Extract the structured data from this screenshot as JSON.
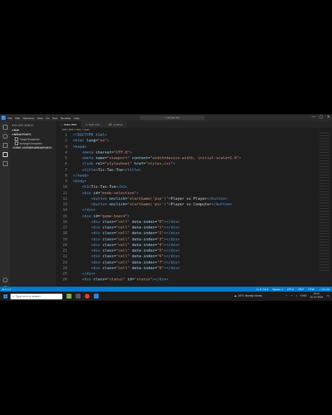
{
  "window": {
    "menu": [
      "File",
      "Edit",
      "Selection",
      "View",
      "Go",
      "Run",
      "Terminal",
      "Help"
    ],
    "search": "tic-tac-toe",
    "controls": [
      "—",
      "▢",
      "✕"
    ]
  },
  "sidebar": {
    "title": "RUN AND DEBUG",
    "run_label": "RUN",
    "breakpoints_label": "BREAKPOINTS",
    "breakpoints": [
      "Caught Exceptions",
      "Uncaught Exceptions"
    ],
    "event_listener_label": "EVENT LISTENER BREAKPOINTS"
  },
  "tabs": [
    {
      "label": "index.html",
      "icon": "html-icon",
      "active": true
    },
    {
      "label": "style.css",
      "icon": "css-icon",
      "active": false
    },
    {
      "label": "script.js",
      "icon": "js-icon",
      "active": false
    }
  ],
  "breadcrumb": "index.html > html > head",
  "editor": {
    "lines": [
      {
        "n": "1",
        "html": "<span class='tag'>&lt;!DOCTYPE html&gt;</span>"
      },
      {
        "n": "2",
        "html": "<span class='tag'>&lt;html</span> <span class='attr'>lang</span>=<span class='str'>\"en\"</span><span class='tag'>&gt;</span>"
      },
      {
        "n": "3",
        "html": "<span class='tag'>&lt;head&gt;</span>"
      },
      {
        "n": "4",
        "html": "    <span class='tag'>&lt;meta</span> <span class='attr'>charset</span>=<span class='str'>\"UTF-8\"</span><span class='tag'>&gt;</span>"
      },
      {
        "n": "5",
        "html": "    <span class='tag'>&lt;meta</span> <span class='attr'>name</span>=<span class='str'>\"viewport\"</span> <span class='attr'>content</span>=<span class='str'>\"width=device-width, initial-scale=1.0\"</span><span class='tag'>&gt;</span>"
      },
      {
        "n": "6",
        "html": "    <span class='tag'>&lt;link</span> <span class='attr'>rel</span>=<span class='str'>\"stylesheet\"</span> <span class='attr'>href</span>=<span class='str'>\"styles.css\"</span><span class='tag'>&gt;</span>"
      },
      {
        "n": "7",
        "html": "    <span class='tag'>&lt;title&gt;</span>Tic-Tac-Toe<span class='tag'>&lt;/title&gt;</span>"
      },
      {
        "n": "8",
        "html": "<span class='tag'>&lt;/head&gt;</span>"
      },
      {
        "n": "9",
        "html": "<span class='tag'>&lt;body&gt;</span>"
      },
      {
        "n": "10",
        "html": "    <span class='tag'>&lt;h1&gt;</span>Tic-Tac-Toe<span class='tag'>&lt;/h1&gt;</span>"
      },
      {
        "n": "11",
        "html": "    <span class='tag'>&lt;div</span> <span class='attr'>id</span>=<span class='str'>\"mode-selection\"</span><span class='tag'>&gt;</span>"
      },
      {
        "n": "12",
        "html": "        <span class='tag'>&lt;button</span> <span class='attr'>onclick</span>=<span class='str'>\"startGame('pvp')\"</span><span class='tag'>&gt;</span>Player vs Player<span class='tag'>&lt;/button&gt;</span>"
      },
      {
        "n": "13",
        "html": "        <span class='tag'>&lt;button</span> <span class='attr'>onclick</span>=<span class='str'>\"startGame('pvc')\"</span><span class='tag'>&gt;</span>Player vs Computer<span class='tag'>&lt;/button&gt;</span>"
      },
      {
        "n": "14",
        "html": "    <span class='tag'>&lt;/div&gt;</span>"
      },
      {
        "n": "15",
        "html": "    <span class='tag'>&lt;div</span> <span class='attr'>id</span>=<span class='str'>\"game-board\"</span><span class='tag'>&gt;</span>"
      },
      {
        "n": "16",
        "html": "        <span class='tag'>&lt;div</span> <span class='attr'>class</span>=<span class='str'>\"cell\"</span> <span class='attr'>data-index</span>=<span class='str'>\"0\"</span><span class='tag'>&gt;&lt;/div&gt;</span>"
      },
      {
        "n": "17",
        "html": "        <span class='tag'>&lt;div</span> <span class='attr'>class</span>=<span class='str'>\"cell\"</span> <span class='attr'>data-index</span>=<span class='str'>\"1\"</span><span class='tag'>&gt;&lt;/div&gt;</span>"
      },
      {
        "n": "18",
        "html": "        <span class='tag'>&lt;div</span> <span class='attr'>class</span>=<span class='str'>\"cell\"</span> <span class='attr'>data-index</span>=<span class='str'>\"2\"</span><span class='tag'>&gt;&lt;/div&gt;</span>"
      },
      {
        "n": "19",
        "html": "        <span class='tag'>&lt;div</span> <span class='attr'>class</span>=<span class='str'>\"cell\"</span> <span class='attr'>data-index</span>=<span class='str'>\"3\"</span><span class='tag'>&gt;&lt;/div&gt;</span>"
      },
      {
        "n": "20",
        "html": "        <span class='tag'>&lt;div</span> <span class='attr'>class</span>=<span class='str'>\"cell\"</span> <span class='attr'>data-index</span>=<span class='str'>\"4\"</span><span class='tag'>&gt;&lt;/div&gt;</span>"
      },
      {
        "n": "21",
        "html": "        <span class='tag'>&lt;div</span> <span class='attr'>class</span>=<span class='str'>\"cell\"</span> <span class='attr'>data-index</span>=<span class='str'>\"5\"</span><span class='tag'>&gt;&lt;/div&gt;</span>"
      },
      {
        "n": "22",
        "html": "        <span class='tag'>&lt;div</span> <span class='attr'>class</span>=<span class='str'>\"cell\"</span> <span class='attr'>data-index</span>=<span class='str'>\"6\"</span><span class='tag'>&gt;&lt;/div&gt;</span>"
      },
      {
        "n": "23",
        "html": "        <span class='tag'>&lt;div</span> <span class='attr'>class</span>=<span class='str'>\"cell\"</span> <span class='attr'>data-index</span>=<span class='str'>\"7\"</span><span class='tag'>&gt;&lt;/div&gt;</span>"
      },
      {
        "n": "24",
        "html": "        <span class='tag'>&lt;div</span> <span class='attr'>class</span>=<span class='str'>\"cell\"</span> <span class='attr'>data-index</span>=<span class='str'>\"8\"</span><span class='tag'>&gt;&lt;/div&gt;</span>"
      },
      {
        "n": "25",
        "html": "    <span class='tag'>&lt;/div&gt;</span>"
      },
      {
        "n": "26",
        "html": "    <span class='tag'>&lt;div</span> <span class='attr'>class</span>=<span class='str'>\"status\"</span> <span class='attr'>id</span>=<span class='str'>\"status\"</span><span class='tag'>&gt;&lt;/div&gt;</span>"
      }
    ]
  },
  "statusbar": {
    "left": [
      "⊗ 0  ⚠ 0"
    ],
    "right": [
      "Ln 8, Col 8",
      "Spaces: 4",
      "UTF-8",
      "CRLF",
      "HTML",
      "✓ Go Live"
    ]
  },
  "taskbar": {
    "search_placeholder": "Type here to search",
    "weather": "28°C  Mostly cloudy",
    "lang": "ENG",
    "time": "23:01",
    "date": "01-07-2024"
  },
  "colors": {
    "accent": "#007acc",
    "editor_bg": "#1e1e1e",
    "keyword": "#569cd6",
    "attribute": "#9cdcfe",
    "string": "#ce9178"
  }
}
